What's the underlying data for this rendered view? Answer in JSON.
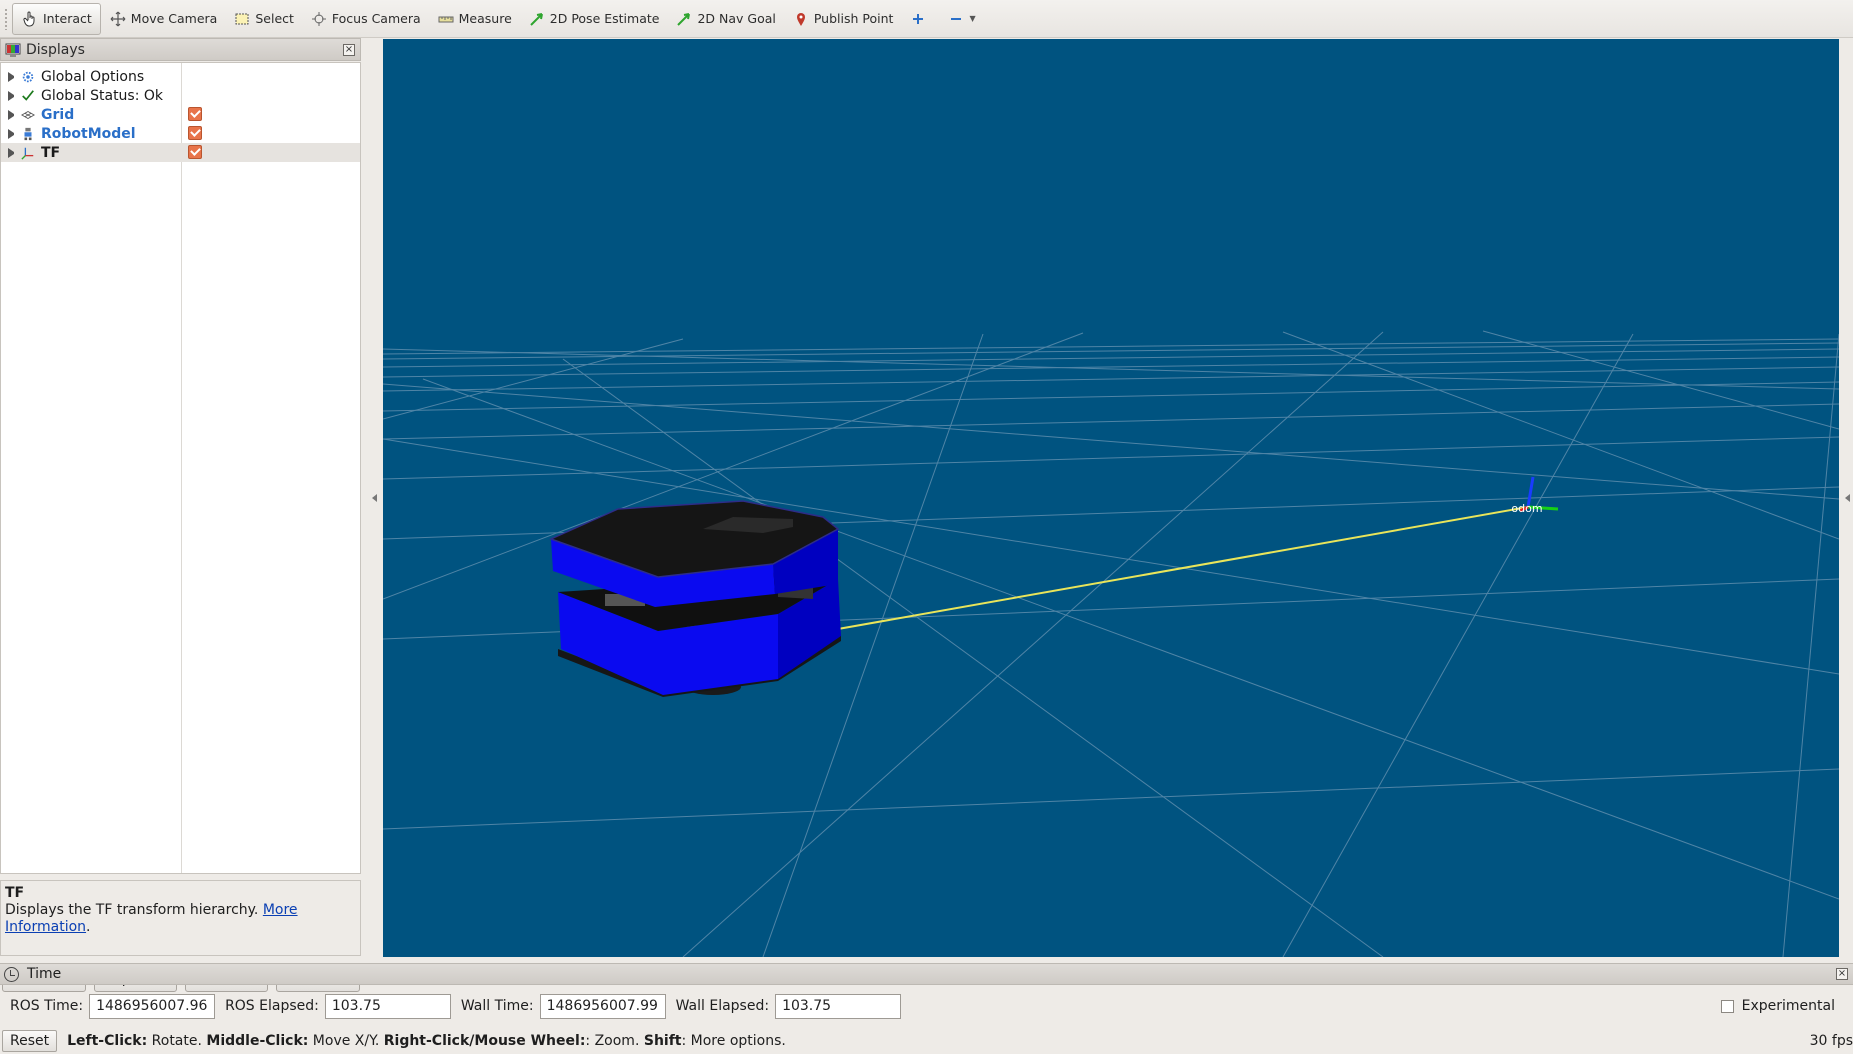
{
  "toolbar": {
    "tools": [
      {
        "label": "Interact",
        "icon": "hand-cursor-icon",
        "active": true
      },
      {
        "label": "Move Camera",
        "icon": "move-camera-icon"
      },
      {
        "label": "Select",
        "icon": "select-box-icon"
      },
      {
        "label": "Focus Camera",
        "icon": "focus-camera-icon"
      },
      {
        "label": "Measure",
        "icon": "ruler-icon"
      },
      {
        "label": "2D Pose Estimate",
        "icon": "green-arrow-icon"
      },
      {
        "label": "2D Nav Goal",
        "icon": "green-arrow-icon"
      },
      {
        "label": "Publish Point",
        "icon": "map-pin-icon"
      }
    ],
    "add_tool_icon": "plus-icon",
    "remove_tool_icon": "minus-icon"
  },
  "displays": {
    "title": "Displays",
    "items": [
      {
        "label": "Global Options",
        "icon": "gear-icon",
        "checked": null
      },
      {
        "label": "Global Status: Ok",
        "icon": "checkmark-icon",
        "checked": null
      },
      {
        "label": "Grid",
        "icon": "grid-icon",
        "checked": true
      },
      {
        "label": "RobotModel",
        "icon": "robot-icon",
        "checked": true
      },
      {
        "label": "TF",
        "icon": "axes-icon",
        "checked": true,
        "selected": true
      }
    ],
    "description": {
      "title": "TF",
      "text": "Displays the TF transform hierarchy. ",
      "link": "More Information",
      "tail": "."
    },
    "buttons": {
      "add": "Add",
      "duplicate": "Duplicate",
      "remove": "Remove",
      "rename": "Rename"
    }
  },
  "viewport": {
    "background": "#005380",
    "frame_label": "odom"
  },
  "time": {
    "title": "Time",
    "ros_time_label": "ROS Time:",
    "ros_time": "1486956007.96",
    "ros_elapsed_label": "ROS Elapsed:",
    "ros_elapsed": "103.75",
    "wall_time_label": "Wall Time:",
    "wall_time": "1486956007.99",
    "wall_elapsed_label": "Wall Elapsed:",
    "wall_elapsed": "103.75",
    "experimental": "Experimental"
  },
  "status": {
    "reset": "Reset",
    "left_click_key": "Left-Click:",
    "left_click_val": " Rotate. ",
    "middle_click_key": "Middle-Click:",
    "middle_click_val": " Move X/Y. ",
    "right_click_key": "Right-Click/Mouse Wheel:",
    "right_click_val": ": Zoom. ",
    "shift_key": "Shift",
    "shift_val": ": More options.",
    "fps": "30 fps"
  }
}
